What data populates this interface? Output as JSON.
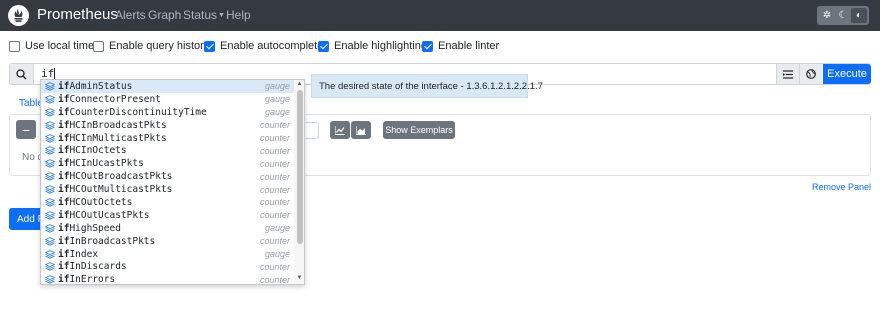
{
  "navbar": {
    "brand": "Prometheus",
    "links": [
      "Alerts",
      "Graph",
      "Status",
      "Help"
    ],
    "theme_icons": [
      "sun-icon",
      "moon-icon",
      "contrast-icon"
    ]
  },
  "options": [
    {
      "label": "Use local time",
      "checked": false
    },
    {
      "label": "Enable query history",
      "checked": false
    },
    {
      "label": "Enable autocomplete",
      "checked": true
    },
    {
      "label": "Enable highlighting",
      "checked": true
    },
    {
      "label": "Enable linter",
      "checked": true
    }
  ],
  "expression": {
    "value": "if",
    "execute_label": "Execute"
  },
  "panel": {
    "tab_label": "Table",
    "no_data_text": "No d",
    "show_exemplars_label": "Show Exemplars",
    "remove_panel_label": "Remove Panel",
    "add_panel_label": "Add P"
  },
  "autocomplete": {
    "match": "if",
    "items": [
      {
        "rest": "AdminStatus",
        "type": "gauge"
      },
      {
        "rest": "ConnectorPresent",
        "type": "gauge"
      },
      {
        "rest": "CounterDiscontinuityTime",
        "type": "gauge"
      },
      {
        "rest": "HCInBroadcastPkts",
        "type": "counter"
      },
      {
        "rest": "HCInMulticastPkts",
        "type": "counter"
      },
      {
        "rest": "HCInOctets",
        "type": "counter"
      },
      {
        "rest": "HCInUcastPkts",
        "type": "counter"
      },
      {
        "rest": "HCOutBroadcastPkts",
        "type": "counter"
      },
      {
        "rest": "HCOutMulticastPkts",
        "type": "counter"
      },
      {
        "rest": "HCOutOctets",
        "type": "counter"
      },
      {
        "rest": "HCOutUcastPkts",
        "type": "counter"
      },
      {
        "rest": "HighSpeed",
        "type": "gauge"
      },
      {
        "rest": "InBroadcastPkts",
        "type": "counter"
      },
      {
        "rest": "Index",
        "type": "gauge"
      },
      {
        "rest": "InDiscards",
        "type": "counter"
      },
      {
        "rest": "InErrors",
        "type": "counter"
      }
    ],
    "selected_index": 0,
    "info": "The desired state of the interface - 1.3.6.1.2.1.2.2.1.7"
  },
  "colors": {
    "navbar_bg": "#343a40",
    "accent": "#0d6efd",
    "selected_row": "#dbe8f7",
    "info_bg": "#d8e8f5"
  }
}
